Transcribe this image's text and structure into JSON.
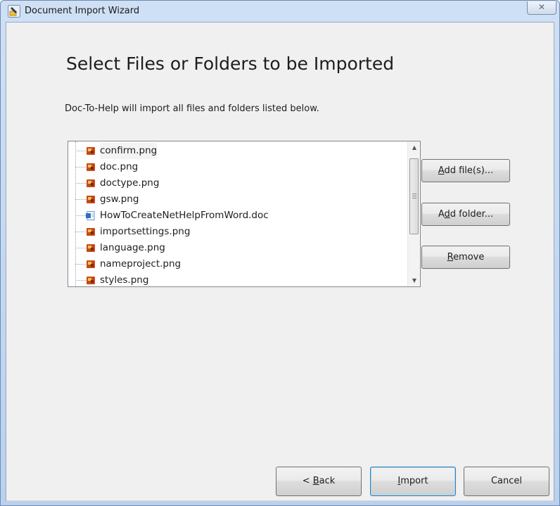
{
  "window": {
    "title": "Document Import Wizard",
    "close_glyph": "✕"
  },
  "heading": "Select Files or Folders to be Imported",
  "description": "Doc-To-Help will import all files and folders listed below.",
  "files": [
    {
      "name": "confirm.png",
      "icon": "image-file-icon",
      "selected": true
    },
    {
      "name": "doc.png",
      "icon": "image-file-icon"
    },
    {
      "name": "doctype.png",
      "icon": "image-file-icon"
    },
    {
      "name": "gsw.png",
      "icon": "image-file-icon"
    },
    {
      "name": "HowToCreateNetHelpFromWord.doc",
      "icon": "word-document-icon"
    },
    {
      "name": "importsettings.png",
      "icon": "image-file-icon"
    },
    {
      "name": "language.png",
      "icon": "image-file-icon"
    },
    {
      "name": "nameproject.png",
      "icon": "image-file-icon"
    },
    {
      "name": "styles.png",
      "icon": "image-file-icon"
    }
  ],
  "scrollbar": {
    "up_glyph": "▲",
    "down_glyph": "▼"
  },
  "side_buttons": {
    "add_files": {
      "mnemonic": "A",
      "rest": "dd file(s)..."
    },
    "add_folder": {
      "pre": "A",
      "mnemonic": "d",
      "rest": "d folder..."
    },
    "remove": {
      "mnemonic": "R",
      "rest": "emove"
    }
  },
  "bottom_buttons": {
    "back": {
      "pre": "< ",
      "mnemonic": "B",
      "rest": "ack"
    },
    "import": {
      "mnemonic": "I",
      "rest": "mport"
    },
    "cancel": {
      "label": "Cancel"
    }
  },
  "colors": {
    "image_icon": "#c84a16",
    "word_icon": "#2f6fbf",
    "accent_border": "#3c7fb1"
  }
}
